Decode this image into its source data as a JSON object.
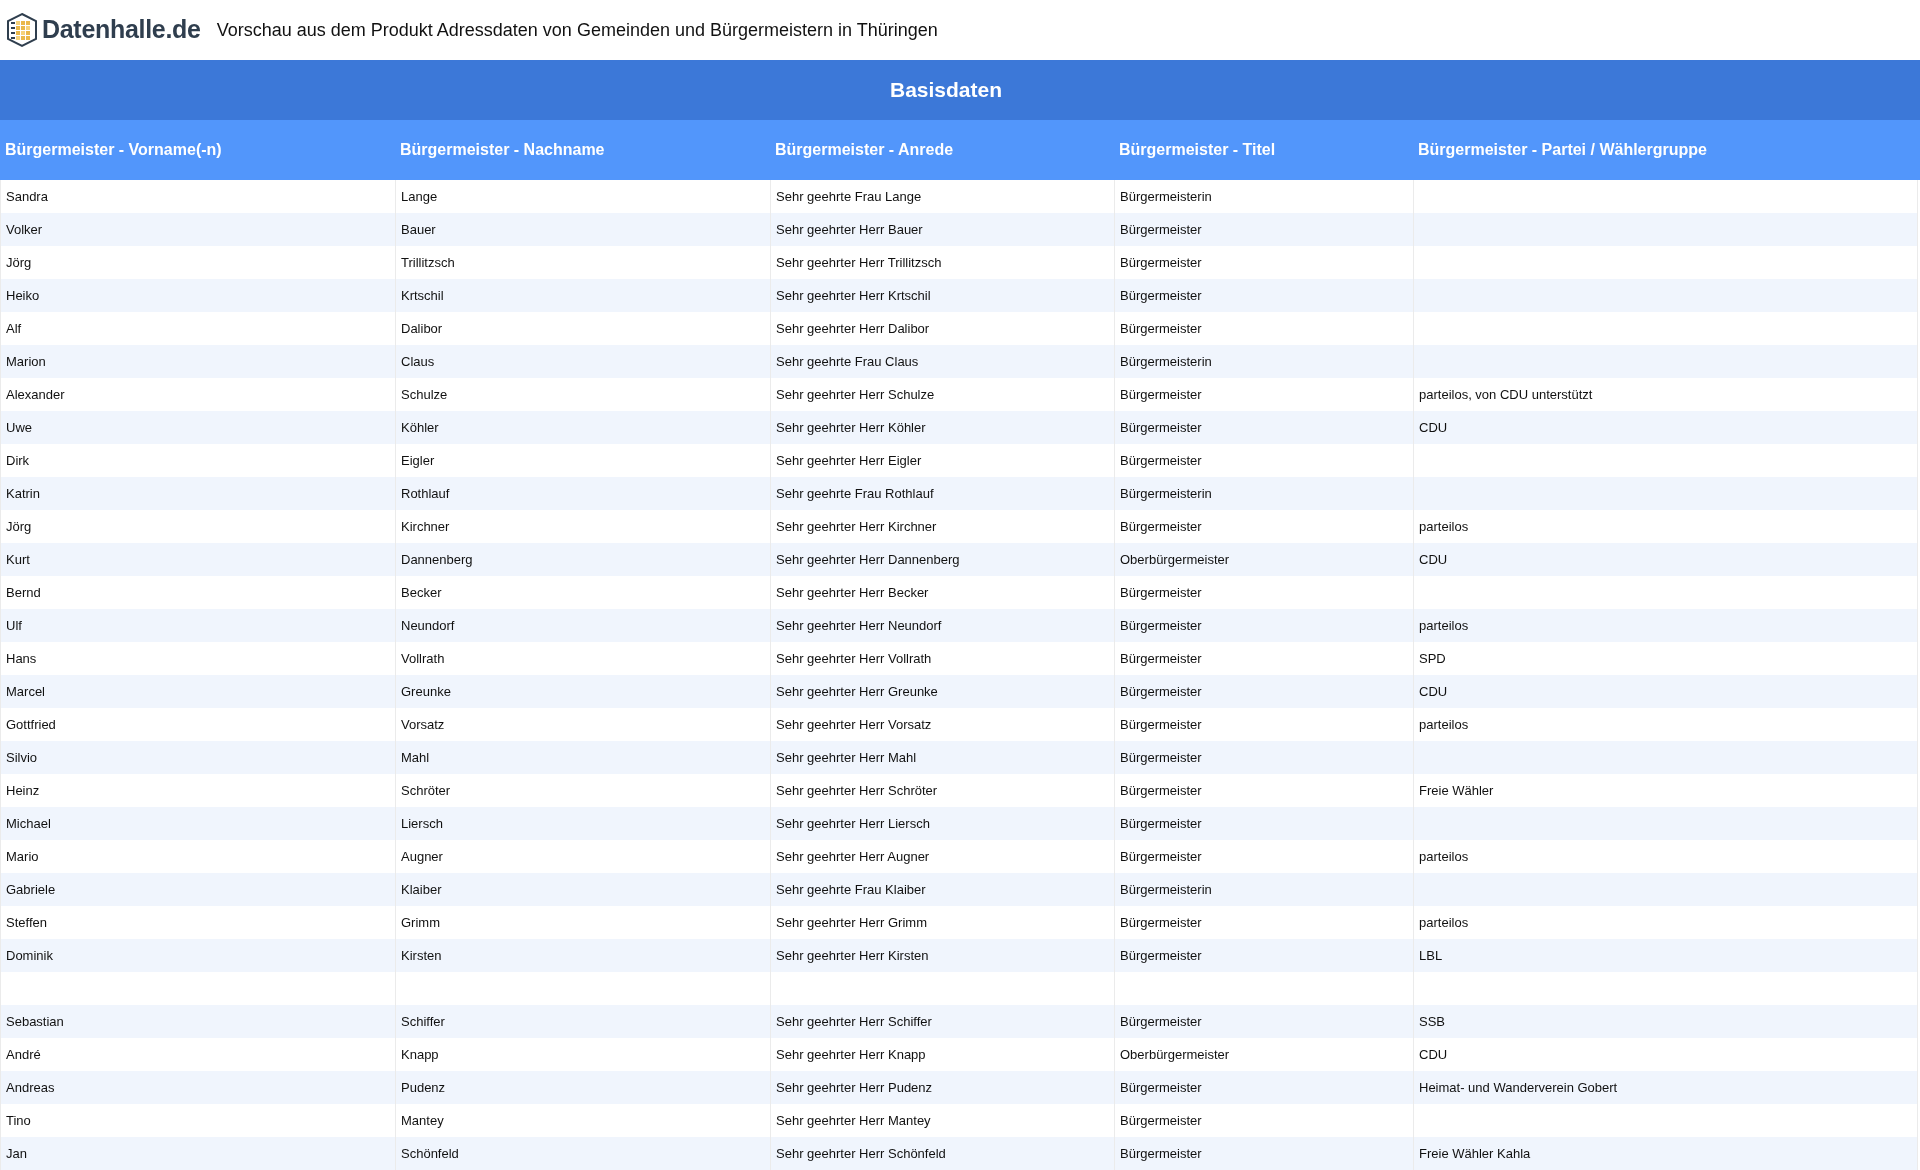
{
  "header": {
    "logo_text": "Datenhalle.de",
    "title": "Vorschau aus dem Produkt Adressdaten von Gemeinden und Bürgermeistern in Thüringen"
  },
  "table": {
    "banner": "Basisdaten",
    "columns": [
      "Bürgermeister - Vorname(-n)",
      "Bürgermeister - Nachname",
      "Bürgermeister - Anrede",
      "Bürgermeister - Titel",
      "Bürgermeister - Partei / Wählergruppe"
    ],
    "rows": [
      {
        "vorname": "Sandra",
        "nachname": "Lange",
        "anrede": "Sehr geehrte Frau Lange",
        "titel": "Bürgermeisterin"
      },
      {
        "vorname": "Volker",
        "nachname": "Bauer",
        "anrede": "Sehr geehrter Herr Bauer",
        "titel": "Bürgermeister"
      },
      {
        "vorname": "Jörg",
        "nachname": "Trillitzsch",
        "anrede": "Sehr geehrter Herr Trillitzsch",
        "titel": "Bürgermeister"
      },
      {
        "vorname": "Heiko",
        "nachname": "Krtschil",
        "anrede": "Sehr geehrter Herr Krtschil",
        "titel": "Bürgermeister"
      },
      {
        "vorname": "Alf",
        "nachname": "Dalibor",
        "anrede": "Sehr geehrter Herr Dalibor",
        "titel": "Bürgermeister"
      },
      {
        "vorname": "Marion",
        "nachname": "Claus",
        "anrede": "Sehr geehrte Frau Claus",
        "titel": "Bürgermeisterin"
      },
      {
        "vorname": "Alexander",
        "nachname": "Schulze",
        "anrede": "Sehr geehrter Herr Schulze",
        "titel": "Bürgermeister",
        "partei": "parteilos, von CDU unterstützt"
      },
      {
        "vorname": "Uwe",
        "nachname": "Köhler",
        "anrede": "Sehr geehrter Herr Köhler",
        "titel": "Bürgermeister",
        "partei": "CDU"
      },
      {
        "vorname": "Dirk",
        "nachname": "Eigler",
        "anrede": "Sehr geehrter Herr Eigler",
        "titel": "Bürgermeister"
      },
      {
        "vorname": "Katrin",
        "nachname": "Rothlauf",
        "anrede": "Sehr geehrte Frau Rothlauf",
        "titel": "Bürgermeisterin"
      },
      {
        "vorname": "Jörg",
        "nachname": "Kirchner",
        "anrede": "Sehr geehrter Herr Kirchner",
        "titel": "Bürgermeister",
        "partei": "parteilos"
      },
      {
        "vorname": "Kurt",
        "nachname": "Dannenberg",
        "anrede": "Sehr geehrter Herr Dannenberg",
        "titel": "Oberbürgermeister",
        "partei": "CDU"
      },
      {
        "vorname": "Bernd",
        "nachname": "Becker",
        "anrede": "Sehr geehrter Herr Becker",
        "titel": "Bürgermeister"
      },
      {
        "vorname": "Ulf",
        "nachname": "Neundorf",
        "anrede": "Sehr geehrter Herr Neundorf",
        "titel": "Bürgermeister",
        "partei": "parteilos"
      },
      {
        "vorname": "Hans",
        "nachname": "Vollrath",
        "anrede": "Sehr geehrter Herr Vollrath",
        "titel": "Bürgermeister",
        "partei": "SPD"
      },
      {
        "vorname": "Marcel",
        "nachname": "Greunke",
        "anrede": "Sehr geehrter Herr Greunke",
        "titel": "Bürgermeister",
        "partei": "CDU"
      },
      {
        "vorname": "Gottfried",
        "nachname": "Vorsatz",
        "anrede": "Sehr geehrter Herr Vorsatz",
        "titel": "Bürgermeister",
        "partei": "parteilos"
      },
      {
        "vorname": "Silvio",
        "nachname": "Mahl",
        "anrede": "Sehr geehrter Herr Mahl",
        "titel": "Bürgermeister"
      },
      {
        "vorname": "Heinz",
        "nachname": "Schröter",
        "anrede": "Sehr geehrter Herr Schröter",
        "titel": "Bürgermeister",
        "partei": "Freie Wähler"
      },
      {
        "vorname": "Michael",
        "nachname": "Liersch",
        "anrede": "Sehr geehrter Herr Liersch",
        "titel": "Bürgermeister"
      },
      {
        "vorname": "Mario",
        "nachname": "Augner",
        "anrede": "Sehr geehrter Herr Augner",
        "titel": "Bürgermeister",
        "partei": "parteilos"
      },
      {
        "vorname": "Gabriele",
        "nachname": "Klaiber",
        "anrede": "Sehr geehrte Frau Klaiber",
        "titel": "Bürgermeisterin"
      },
      {
        "vorname": "Steffen",
        "nachname": "Grimm",
        "anrede": "Sehr geehrter Herr Grimm",
        "titel": "Bürgermeister",
        "partei": "parteilos"
      },
      {
        "vorname": "Dominik",
        "nachname": "Kirsten",
        "anrede": "Sehr geehrter Herr Kirsten",
        "titel": "Bürgermeister",
        "partei": "LBL"
      },
      {},
      {
        "vorname": "Sebastian",
        "nachname": "Schiffer",
        "anrede": "Sehr geehrter Herr Schiffer",
        "titel": "Bürgermeister",
        "partei": "SSB"
      },
      {
        "vorname": "André",
        "nachname": "Knapp",
        "anrede": "Sehr geehrter Herr Knapp",
        "titel": "Oberbürgermeister",
        "partei": "CDU"
      },
      {
        "vorname": "Andreas",
        "nachname": "Pudenz",
        "anrede": "Sehr geehrter Herr Pudenz",
        "titel": "Bürgermeister",
        "partei": "Heimat- und Wanderverein Gobert"
      },
      {
        "vorname": "Tino",
        "nachname": "Mantey",
        "anrede": "Sehr geehrter Herr Mantey",
        "titel": "Bürgermeister"
      },
      {
        "vorname": "Jan",
        "nachname": "Schönfeld",
        "anrede": "Sehr geehrter Herr Schönfeld",
        "titel": "Bürgermeister",
        "partei": "Freie Wähler Kahla"
      }
    ]
  }
}
